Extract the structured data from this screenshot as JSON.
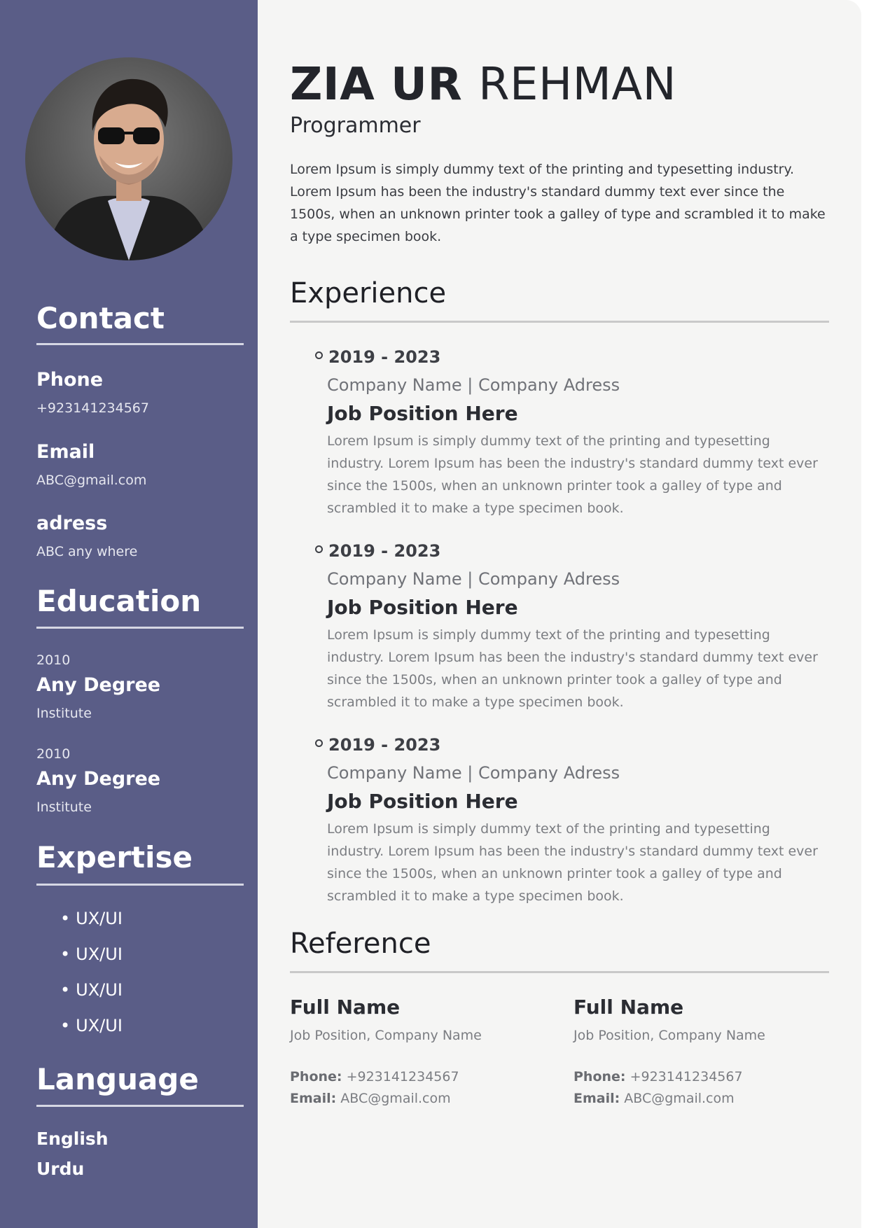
{
  "sidebar": {
    "photo_alt": "profile photo",
    "contact": {
      "heading": "Contact",
      "phone_label": "Phone",
      "phone_value": "+923141234567",
      "email_label": "Email",
      "email_value": "ABC@gmail.com",
      "address_label": "adress",
      "address_value": "ABC any where"
    },
    "education": {
      "heading": "Education",
      "items": [
        {
          "year": "2010",
          "degree": "Any Degree",
          "institute": "Institute"
        },
        {
          "year": "2010",
          "degree": "Any Degree",
          "institute": "Institute"
        }
      ]
    },
    "expertise": {
      "heading": "Expertise",
      "items": [
        "UX/UI",
        "UX/UI",
        "UX/UI",
        "UX/UI"
      ]
    },
    "language": {
      "heading": "Language",
      "items": [
        "English",
        "Urdu"
      ]
    }
  },
  "header": {
    "first_name": "ZIA UR",
    "last_name": "REHMAN",
    "role": "Programmer",
    "summary": "Lorem Ipsum is simply dummy text of the printing and typesetting industry. Lorem Ipsum has been the industry's standard dummy text ever since the 1500s, when an unknown printer took a galley of type and scrambled it to make a type specimen book."
  },
  "experience": {
    "heading": "Experience",
    "items": [
      {
        "dates": "2019 - 2023",
        "company": "Company Name | Company Adress",
        "position": "Job Position Here",
        "description": "Lorem Ipsum is simply dummy text of the printing and typesetting industry. Lorem Ipsum has been the industry's standard dummy text ever since the 1500s, when an unknown printer took a galley of type and scrambled it to make a type specimen book."
      },
      {
        "dates": "2019 - 2023",
        "company": "Company Name | Company Adress",
        "position": "Job Position Here",
        "description": "Lorem Ipsum is simply dummy text of the printing and typesetting industry. Lorem Ipsum has been the industry's standard dummy text ever since the 1500s, when an unknown printer took a galley of type and scrambled it to make a type specimen book."
      },
      {
        "dates": "2019 - 2023",
        "company": "Company Name | Company Adress",
        "position": "Job Position Here",
        "description": "Lorem Ipsum is simply dummy text of the printing and typesetting industry. Lorem Ipsum has been the industry's standard dummy text ever since the 1500s, when an unknown printer took a galley of type and scrambled it to make a type specimen book."
      }
    ]
  },
  "reference": {
    "heading": "Reference",
    "phone_label": "Phone:",
    "email_label": "Email:",
    "items": [
      {
        "name": "Full Name",
        "position": "Job Position, Company Name",
        "phone": "+923141234567",
        "email": "ABC@gmail.com"
      },
      {
        "name": "Full Name",
        "position": "Job Position, Company Name",
        "phone": "+923141234567",
        "email": "ABC@gmail.com"
      }
    ]
  },
  "colors": {
    "sidebar_bg": "#5a5d87",
    "main_bg": "#f5f5f4",
    "heading_text": "#1f2026",
    "muted_text": "#7b7d82"
  }
}
